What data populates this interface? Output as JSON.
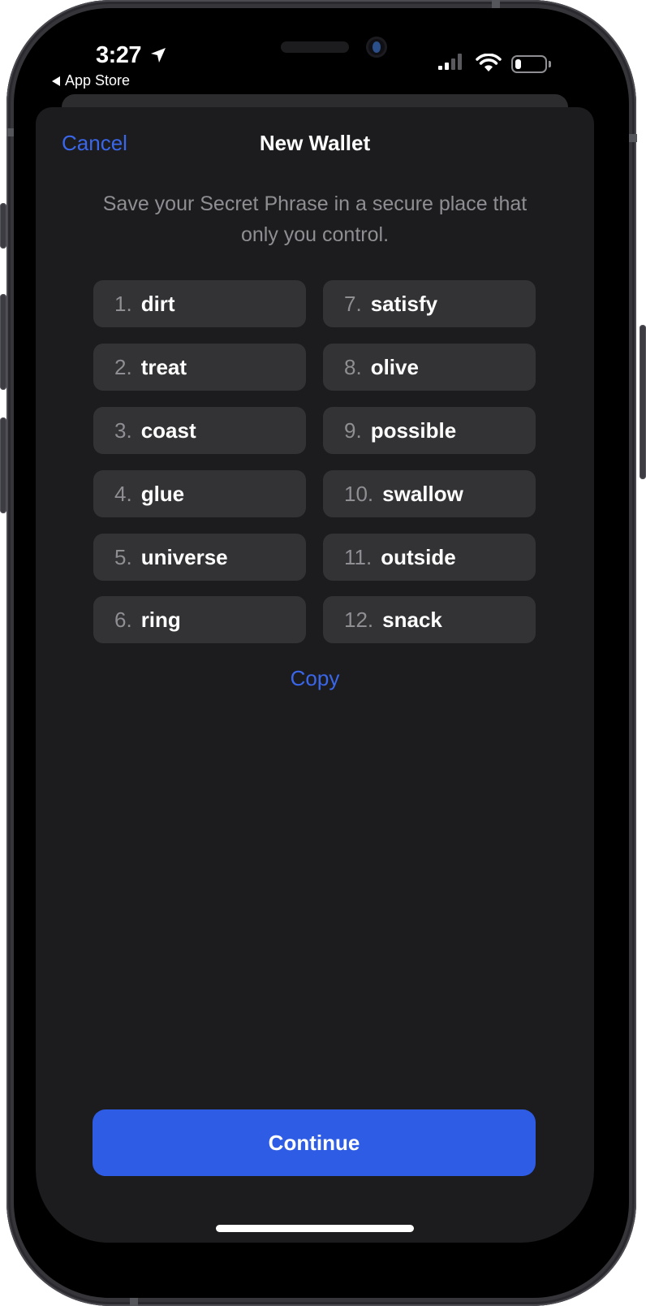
{
  "status_bar": {
    "time": "3:27",
    "location_icon": "location-arrow-icon",
    "back_app_label": "App Store",
    "signal_bars_active": 1,
    "signal_bars_total": 4,
    "wifi_icon": "wifi-icon",
    "battery_level_percent": 22
  },
  "header": {
    "cancel_label": "Cancel",
    "title": "New Wallet"
  },
  "subtitle": "Save your Secret Phrase in a secure place that only you control.",
  "secret_phrase": [
    {
      "index": "1.",
      "word": "dirt"
    },
    {
      "index": "2.",
      "word": "treat"
    },
    {
      "index": "3.",
      "word": "coast"
    },
    {
      "index": "4.",
      "word": "glue"
    },
    {
      "index": "5.",
      "word": "universe"
    },
    {
      "index": "6.",
      "word": "ring"
    },
    {
      "index": "7.",
      "word": "satisfy"
    },
    {
      "index": "8.",
      "word": "olive"
    },
    {
      "index": "9.",
      "word": "possible"
    },
    {
      "index": "10.",
      "word": "swallow"
    },
    {
      "index": "11.",
      "word": "outside"
    },
    {
      "index": "12.",
      "word": "snack"
    }
  ],
  "copy_label": "Copy",
  "continue_label": "Continue",
  "colors": {
    "accent": "#3a66ea",
    "primary_button": "#2e5ce5",
    "sheet_background": "#1c1c1e",
    "word_chip_background": "#333335",
    "secondary_text": "#8e8e93"
  }
}
